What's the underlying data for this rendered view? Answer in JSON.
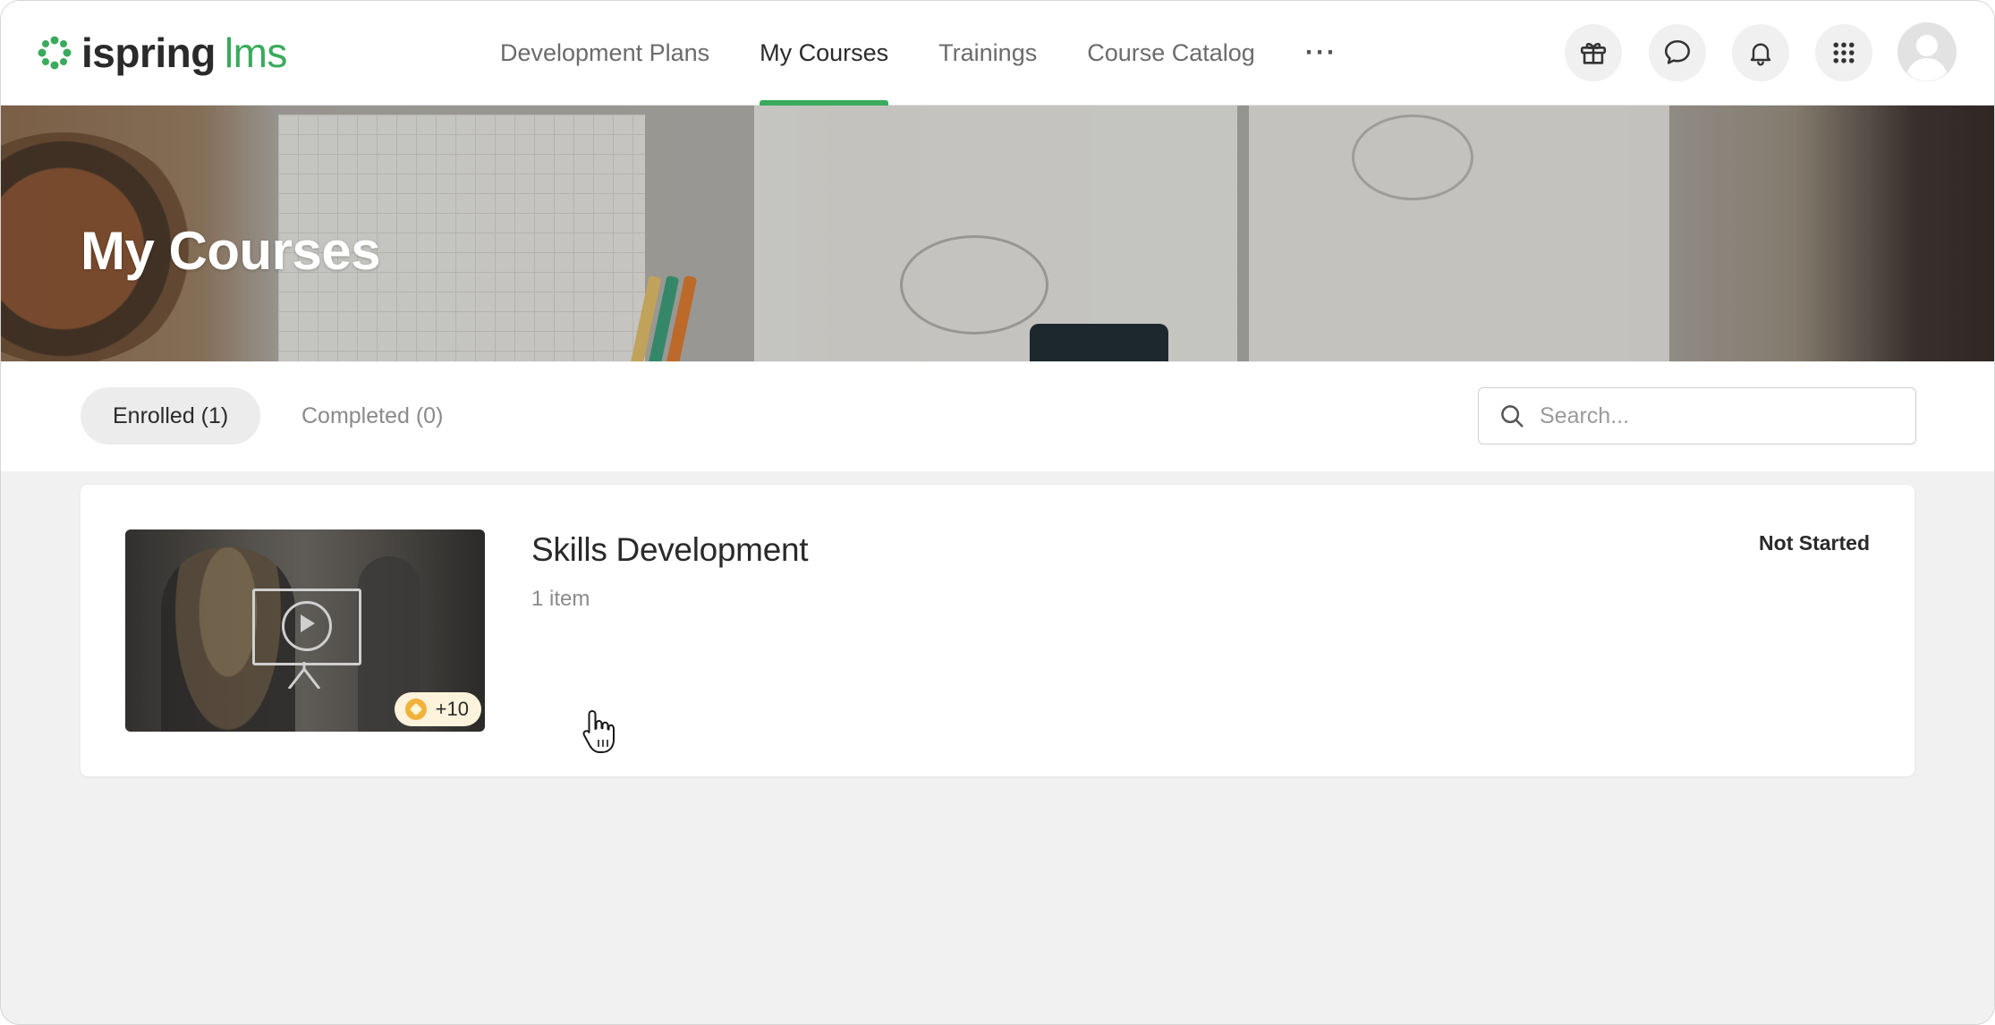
{
  "brand": {
    "name": "ispring",
    "suffix": "lms",
    "accent": "#3aaa5c"
  },
  "nav": {
    "items": [
      {
        "label": "Development Plans",
        "active": false
      },
      {
        "label": "My Courses",
        "active": true
      },
      {
        "label": "Trainings",
        "active": false
      },
      {
        "label": "Course Catalog",
        "active": false
      }
    ],
    "more_label": "···"
  },
  "header_icons": [
    "gift-icon",
    "chat-icon",
    "bell-icon",
    "apps-grid-icon",
    "avatar"
  ],
  "hero": {
    "title": "My Courses"
  },
  "tabs": [
    {
      "label": "Enrolled (1)",
      "active": true
    },
    {
      "label": "Completed (0)",
      "active": false
    }
  ],
  "search": {
    "placeholder": "Search...",
    "value": ""
  },
  "courses": [
    {
      "title": "Skills Development",
      "meta": "1 item",
      "status": "Not Started",
      "points": "+10"
    }
  ]
}
